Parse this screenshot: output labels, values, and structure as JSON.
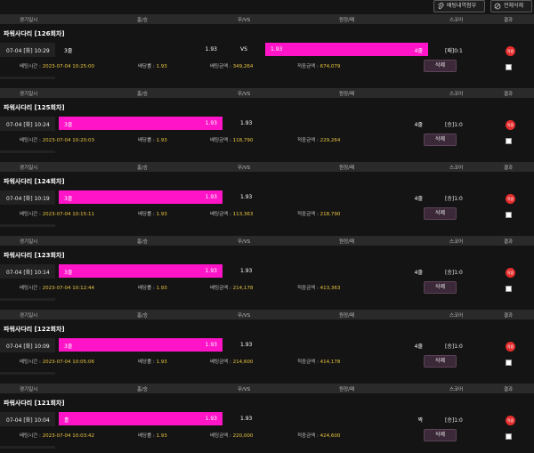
{
  "toolbar": {
    "history_label": "배팅내역첨부",
    "delete_all_label": "전체삭제"
  },
  "columns": {
    "date": "경기일시",
    "home": "홈/승",
    "draw": "무/VS",
    "away": "원정/패",
    "score": "스코어",
    "result": "결과"
  },
  "meta_labels": {
    "bet_time": "배팅시간 :",
    "odds": "배당률 :",
    "amount": "배팅금액 :",
    "win_amount": "적중금액 :",
    "delete": "삭제"
  },
  "result_badge": "적중",
  "bets": [
    {
      "round": "파워사다리 [126회차]",
      "date": "07-04 [화] 10:29",
      "home": "3줄",
      "home_odds": "1.93",
      "draw": "VS",
      "away_odds": "1.93",
      "away": "4줄",
      "score": "[패]0:1",
      "selected": "away",
      "bet_time": "2023-07-04 10:25:00",
      "odds": "1.93",
      "amount": "349,264",
      "win_amount": "674,079"
    },
    {
      "round": "파워사다리 [125회차]",
      "date": "07-04 [화] 10:24",
      "home": "3줄",
      "home_odds": "1.93",
      "draw": "1.93",
      "away_odds": "",
      "away": "4줄",
      "score": "[승]1:0",
      "selected": "home",
      "bet_time": "2023-07-04 10:20:03",
      "odds": "1.93",
      "amount": "118,790",
      "win_amount": "229,264"
    },
    {
      "round": "파워사다리 [124회차]",
      "date": "07-04 [화] 10:19",
      "home": "3줄",
      "home_odds": "1.93",
      "draw": "1.93",
      "away_odds": "",
      "away": "4줄",
      "score": "[승]1:0",
      "selected": "home",
      "bet_time": "2023-07-04 10:15:11",
      "odds": "1.93",
      "amount": "113,363",
      "win_amount": "218,790"
    },
    {
      "round": "파워사다리 [123회차]",
      "date": "07-04 [화] 10:14",
      "home": "3줄",
      "home_odds": "1.93",
      "draw": "1.93",
      "away_odds": "",
      "away": "4줄",
      "score": "[승]1:0",
      "selected": "home",
      "bet_time": "2023-07-04 10:12:44",
      "odds": "1.93",
      "amount": "214,178",
      "win_amount": "413,363"
    },
    {
      "round": "파워사다리 [122회차]",
      "date": "07-04 [화] 10:09",
      "home": "3줄",
      "home_odds": "1.93",
      "draw": "1.93",
      "away_odds": "",
      "away": "4줄",
      "score": "[승]1:0",
      "selected": "home",
      "bet_time": "2023-07-04 10:05:06",
      "odds": "1.93",
      "amount": "214,600",
      "win_amount": "414,178"
    },
    {
      "round": "파워사다리 [121회차]",
      "date": "07-04 [화] 10:04",
      "home": "홀",
      "home_odds": "1.93",
      "draw": "1.93",
      "away_odds": "",
      "away": "짝",
      "score": "[승]1:0",
      "selected": "home",
      "bet_time": "2023-07-04 10:03:42",
      "odds": "1.93",
      "amount": "220,000",
      "win_amount": "424,600"
    }
  ],
  "colors": {
    "highlight": "#ff14c8",
    "gold": "#e9c440",
    "badge": "#e52d2d"
  }
}
